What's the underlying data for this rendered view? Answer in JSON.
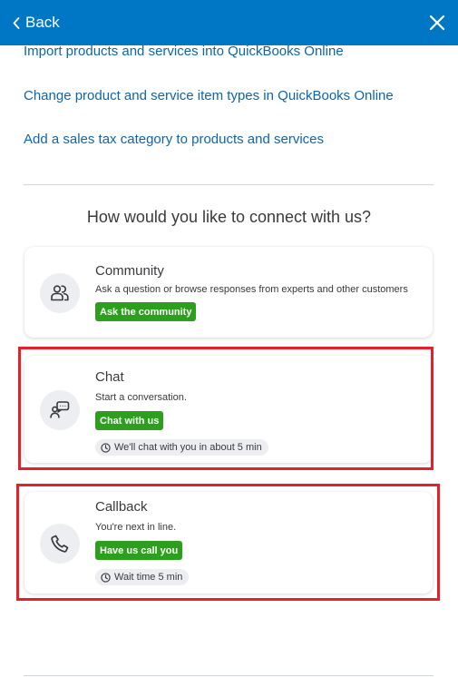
{
  "header": {
    "back_label": "Back",
    "close_icon": "close-icon"
  },
  "links": [
    "Import products and services into QuickBooks Online",
    "Change product and service item types in QuickBooks Online",
    "Add a sales tax category to products and services"
  ],
  "connect": {
    "heading": "How would you like to connect with us?",
    "options": [
      {
        "title": "Community",
        "icon": "people-icon",
        "description": "Ask a question or browse responses from experts and other customers",
        "button_label": "Ask the community"
      },
      {
        "title": "Chat",
        "icon": "chat-icon",
        "description": "Start a conversation.",
        "button_label": "Chat with us",
        "wait_text": "We'll chat with you in about 5 min"
      },
      {
        "title": "Callback",
        "icon": "phone-icon",
        "description": "You're next in line.",
        "button_label": "Have us call you",
        "wait_text": "Wait time 5 min"
      }
    ]
  },
  "colors": {
    "header": "#0077c5",
    "link": "#0d66a8",
    "button": "#2ca01c",
    "highlight": "#e4202a"
  }
}
